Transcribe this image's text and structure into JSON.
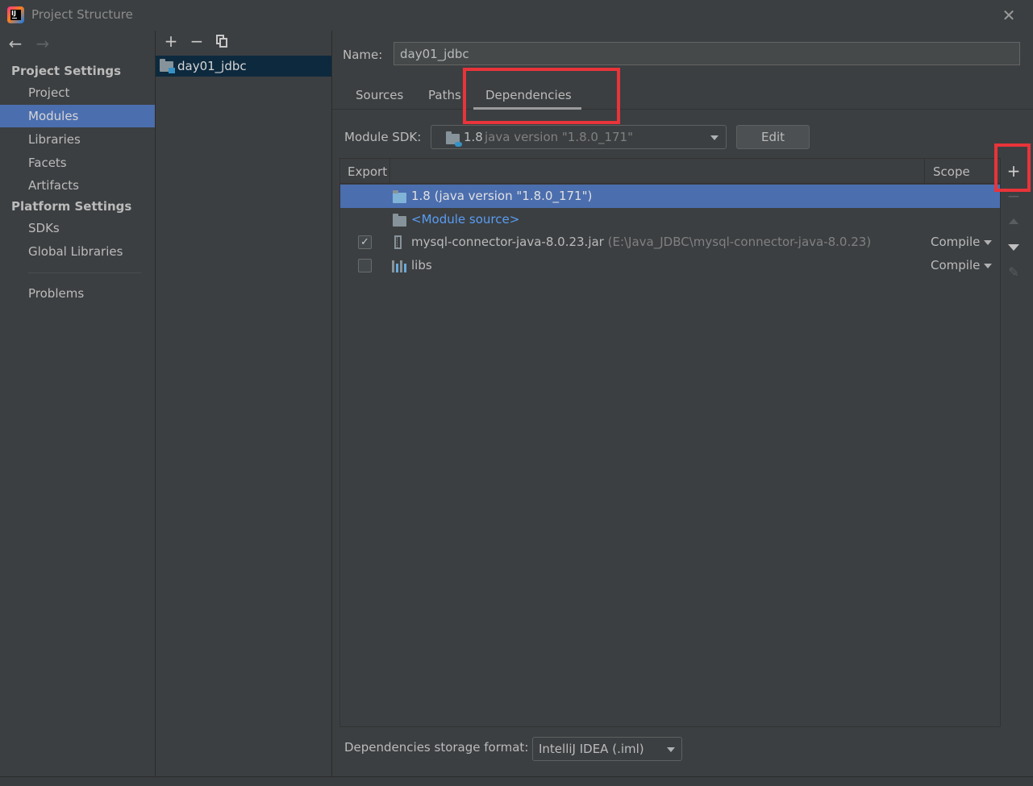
{
  "window": {
    "title": "Project Structure",
    "close_glyph": "✕"
  },
  "nav": {
    "back_glyph": "←",
    "forward_glyph": "→",
    "project_settings_header": "Project Settings",
    "platform_settings_header": "Platform Settings",
    "items": [
      {
        "label": "Project",
        "selected": false
      },
      {
        "label": "Modules",
        "selected": true
      },
      {
        "label": "Libraries",
        "selected": false
      },
      {
        "label": "Facets",
        "selected": false
      },
      {
        "label": "Artifacts",
        "selected": false
      }
    ],
    "platform_items": [
      {
        "label": "SDKs"
      },
      {
        "label": "Global Libraries"
      }
    ],
    "problems": "Problems"
  },
  "modules": {
    "toolbar": {
      "add": "+",
      "remove": "−"
    },
    "items": [
      {
        "label": "day01_jdbc",
        "selected": true
      }
    ]
  },
  "module": {
    "name_label": "Name:",
    "name_value": "day01_jdbc",
    "tabs": [
      {
        "label": "Sources"
      },
      {
        "label": "Paths"
      },
      {
        "label": "Dependencies",
        "active": true
      }
    ],
    "sdk_label": "Module SDK:",
    "sdk_version": "1.8",
    "sdk_description": "java version \"1.8.0_171\"",
    "edit_button": "Edit",
    "table": {
      "columns": [
        "Export",
        "Scope"
      ],
      "rows": [
        {
          "name": "1.8 (java version \"1.8.0_171\")",
          "selected": true
        },
        {
          "name": "<Module source>"
        },
        {
          "name": "mysql-connector-java-8.0.23.jar",
          "path": "(E:\\Java_JDBC\\mysql-connector-java-8.0.23)",
          "exported": true,
          "scope": "Compile"
        },
        {
          "name": "libs",
          "exported": false,
          "scope": "Compile"
        }
      ]
    },
    "side_toolbar": {
      "add": "+",
      "remove": "−",
      "edit": "✎"
    },
    "storage_label": "Dependencies storage format:",
    "storage_value": "IntelliJ IDEA (.iml)"
  },
  "colors": {
    "background": "#3c3f41",
    "selection": "#4b6eaf",
    "link": "#589df6",
    "annotation": "#e8343a"
  }
}
